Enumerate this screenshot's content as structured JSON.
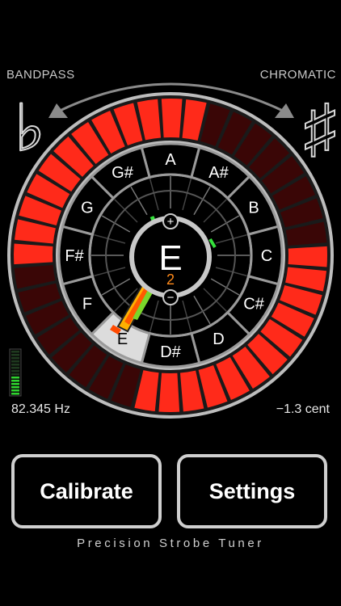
{
  "header": {
    "mode_left": "BANDPASS",
    "mode_right": "CHROMATIC",
    "flat_symbol": "♭",
    "sharp_symbol": "♯"
  },
  "note_wheel": {
    "notes": [
      "A",
      "A#",
      "B",
      "C",
      "C#",
      "D",
      "D#",
      "E",
      "F",
      "F#",
      "G",
      "G#"
    ],
    "selected_note": "E",
    "center_note": "E",
    "center_octave": "2",
    "plus_symbol": "+",
    "minus_symbol": "−"
  },
  "strobe_ring": {
    "segments": [
      1,
      1,
      1,
      1,
      0,
      0,
      0,
      0,
      0,
      0,
      0,
      0,
      1,
      1,
      1,
      1,
      1,
      1,
      1,
      1,
      1,
      1,
      1,
      1,
      0,
      0,
      0,
      0,
      0,
      0,
      0,
      0,
      1,
      1,
      1,
      1,
      1,
      1,
      1,
      1
    ],
    "on_color": "#ff2a1a",
    "off_color": "#3a0606"
  },
  "level_meter": {
    "level": 0.45
  },
  "readouts": {
    "frequency": "82.345 Hz",
    "cents": "−1.3 cent"
  },
  "buttons": {
    "calibrate": "Calibrate",
    "settings": "Settings"
  },
  "footer": {
    "title": "Precision Strobe Tuner"
  }
}
